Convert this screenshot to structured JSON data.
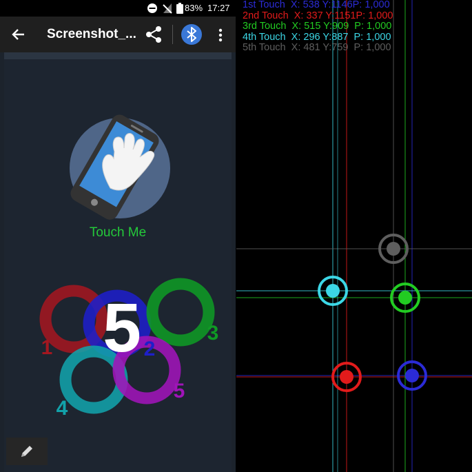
{
  "status_bar": {
    "battery": "83%",
    "time": "17:27"
  },
  "app_bar": {
    "title": "Screenshot_..."
  },
  "main": {
    "touch_label": "Touch Me"
  },
  "touch_markers": [
    {
      "label": "1",
      "color": "#a31720"
    },
    {
      "label": "2",
      "color": "#1e1fc8"
    },
    {
      "label": "3",
      "color": "#0f9a24"
    },
    {
      "label": "4",
      "color": "#12a2aa"
    },
    {
      "label": "5",
      "color": "#a014b8"
    }
  ],
  "big_number": "5",
  "touch_readouts": [
    {
      "text": "1st Touch  X: 538 Y:1146P: 1,000",
      "color": "#2b2bd6"
    },
    {
      "text": "2nd Touch  X: 337 Y:1151P: 1,000",
      "color": "#e21b1b"
    },
    {
      "text": "3rd Touch  X: 515 Y:909  P: 1,000",
      "color": "#22cc22"
    },
    {
      "text": "4th Touch  X: 296 Y:887  P: 1,000",
      "color": "#3cd7e6"
    },
    {
      "text": "5th Touch  X: 481 Y:759  P: 1,000",
      "color": "#5e5e5e"
    }
  ]
}
